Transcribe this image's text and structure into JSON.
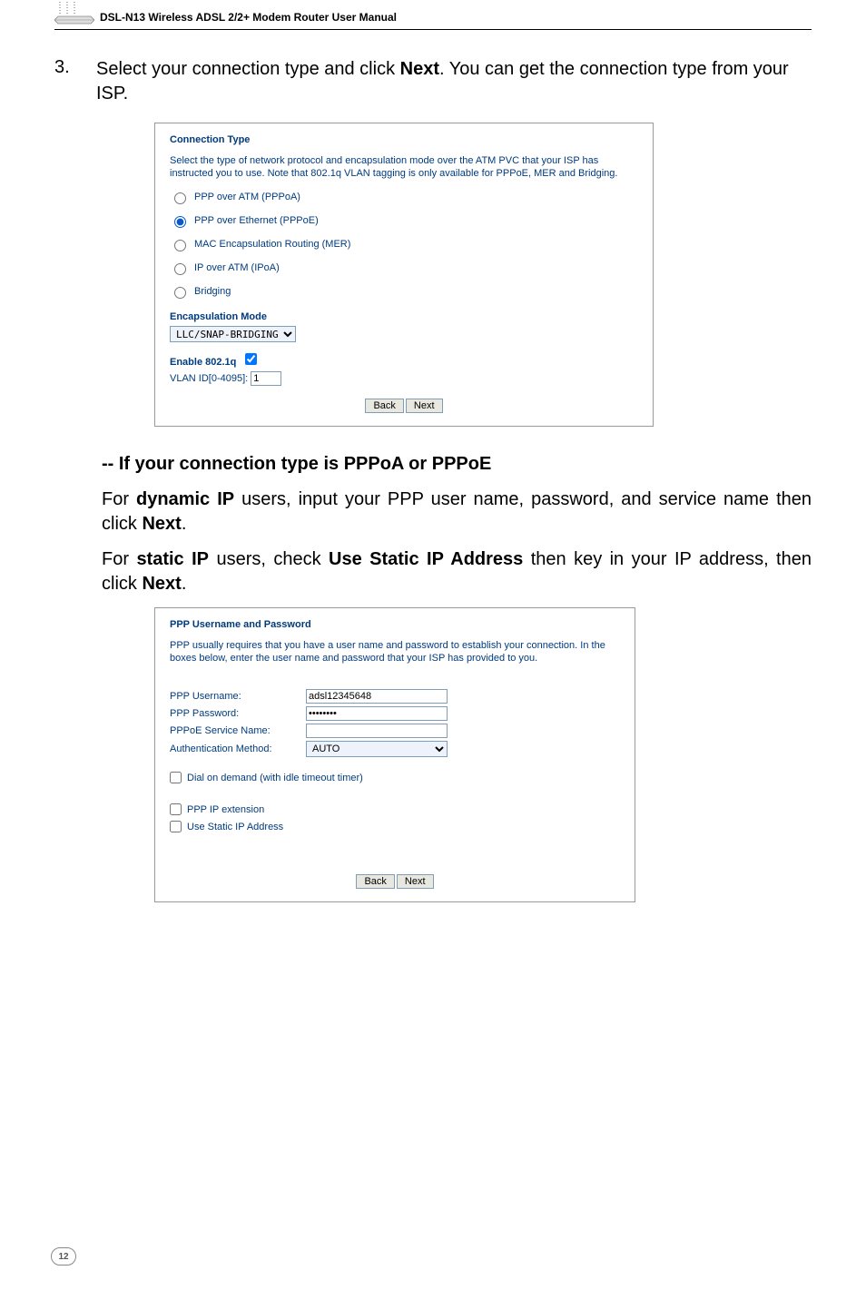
{
  "header": {
    "title": "DSL-N13 Wireless ADSL 2/2+ Modem Router User Manual"
  },
  "step3": {
    "number": "3.",
    "text_before_bold": "Select your connection type and click ",
    "bold_word": "Next",
    "text_after_bold": ". You can get the connection type from your ISP."
  },
  "dialog1": {
    "title": "Connection Type",
    "desc": "Select the type of network protocol and encapsulation mode over the ATM PVC that your ISP has instructed you to use. Note that 802.1q VLAN tagging is only available for PPPoE, MER and Bridging.",
    "options": {
      "pppoa": "PPP over ATM (PPPoA)",
      "pppoe": "PPP over Ethernet (PPPoE)",
      "mer": "MAC Encapsulation Routing (MER)",
      "ipoa": "IP over ATM (IPoA)",
      "bridging": "Bridging"
    },
    "encap_label": "Encapsulation Mode",
    "encap_value": "LLC/SNAP-BRIDGING",
    "enable8021q_label": "Enable 802.1q",
    "vlanid_label": "VLAN ID[0-4095]:",
    "vlanid_value": "1",
    "back_btn": "Back",
    "next_btn": "Next"
  },
  "subheading": "-- If your connection type is PPPoA or PPPoE",
  "para_dynamic": {
    "p1": "For ",
    "b1": "dynamic IP",
    "p2": " users, input your PPP user name, password, and service name then click ",
    "b2": "Next",
    "p3": "."
  },
  "para_static": {
    "p1": "For ",
    "b1": "static IP",
    "p2": " users, check ",
    "b2": "Use Static IP Address",
    "p3": " then key in your IP address, then click ",
    "b3": "Next",
    "p4": "."
  },
  "dialog2": {
    "title": "PPP Username and Password",
    "desc": "PPP usually requires that you have a user name and password to establish your connection. In the boxes below, enter the user name and password that your ISP has provided to you.",
    "username_label": "PPP Username:",
    "username_value": "adsl12345648",
    "password_label": "PPP Password:",
    "password_value": "••••••••",
    "service_label": "PPPoE Service Name:",
    "service_value": "",
    "auth_label": "Authentication Method:",
    "auth_value": "AUTO",
    "dial_label": "Dial on demand (with idle timeout timer)",
    "pppext_label": "PPP IP extension",
    "staticip_label": "Use Static IP Address",
    "back_btn": "Back",
    "next_btn": "Next"
  },
  "page_number": "12"
}
